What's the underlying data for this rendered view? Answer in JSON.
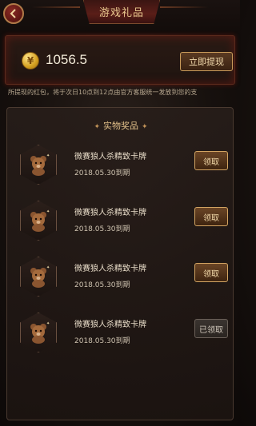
{
  "header": {
    "title": "游戏礼品",
    "back_icon": "chevron-left-icon"
  },
  "balance": {
    "coin_icon": "yen-coin-icon",
    "coin_symbol": "¥",
    "value": "1056.5",
    "withdraw_label": "立即提现"
  },
  "notice": {
    "text": "所提现的红包，将于次日10点到12点由官方客服统一发放到您的支"
  },
  "prizes": {
    "section_title": "实物奖品",
    "items": [
      {
        "name": "微赛狼人杀精致卡牌",
        "expiry": "2018.05.30到期",
        "action_label": "领取",
        "claimed": false
      },
      {
        "name": "微赛狼人杀精致卡牌",
        "expiry": "2018.05.30到期",
        "action_label": "领取",
        "claimed": false
      },
      {
        "name": "微赛狼人杀精致卡牌",
        "expiry": "2018.05.30到期",
        "action_label": "领取",
        "claimed": false
      },
      {
        "name": "微赛狼人杀精致卡牌",
        "expiry": "2018.05.30到期",
        "action_label": "已领取",
        "claimed": true
      }
    ]
  },
  "colors": {
    "accent_gold": "#d2a462",
    "title_text": "#e9c98f",
    "panel_glow": "#8c1e14"
  }
}
